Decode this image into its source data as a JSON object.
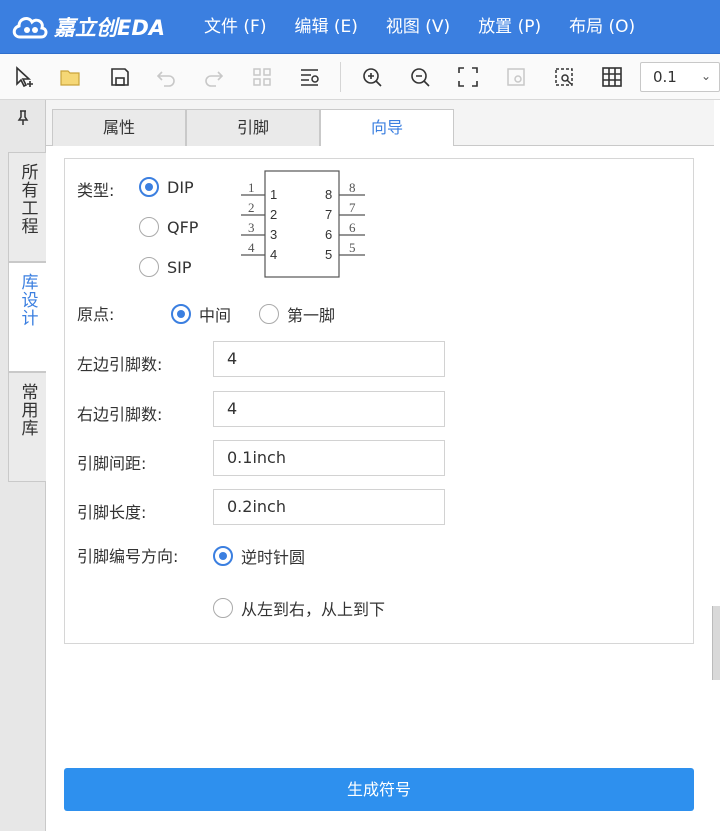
{
  "app": {
    "logo_text": "嘉立创EDA",
    "brand_color": "#3b7fe0",
    "menus": [
      "文件 (F)",
      "编辑 (E)",
      "视图 (V)",
      "放置 (P)",
      "布局 (O)"
    ]
  },
  "toolbar": {
    "icons": [
      "select-icon",
      "folder-icon",
      "save-icon",
      "undo-icon",
      "redo-icon",
      "grid-layout-icon",
      "list-search-icon",
      "zoom-in-icon",
      "zoom-out-icon",
      "fit-view-icon",
      "zoom-area-icon",
      "zoom-selection-icon",
      "grid-icon"
    ],
    "grid_value": "0.1"
  },
  "left_tabs": {
    "pin": "📌",
    "items": [
      {
        "label": "所有工程",
        "active": false
      },
      {
        "label": "库设计",
        "active": true
      },
      {
        "label": "常用库",
        "active": false
      }
    ]
  },
  "tabs": [
    {
      "label": "属性",
      "active": false
    },
    {
      "label": "引脚",
      "active": false
    },
    {
      "label": "向导",
      "active": true
    }
  ],
  "wizard": {
    "type_label": "类型:",
    "type_options": [
      "DIP",
      "QFP",
      "SIP"
    ],
    "type_selected": "DIP",
    "chip_pins_left": [
      "1",
      "2",
      "3",
      "4"
    ],
    "chip_pins_right": [
      "8",
      "7",
      "6",
      "5"
    ],
    "origin_label": "原点:",
    "origin_options": [
      "中间",
      "第一脚"
    ],
    "origin_selected": "中间",
    "left_pins_label": "左边引脚数:",
    "left_pins_value": "4",
    "right_pins_label": "右边引脚数:",
    "right_pins_value": "4",
    "pitch_label": "引脚间距:",
    "pitch_value": "0.1inch",
    "length_label": "引脚长度:",
    "length_value": "0.2inch",
    "numbering_label": "引脚编号方向:",
    "numbering_options": [
      "逆时针圆",
      "从左到右，从上到下"
    ],
    "numbering_selected": "逆时针圆",
    "generate_button": "生成符号"
  }
}
